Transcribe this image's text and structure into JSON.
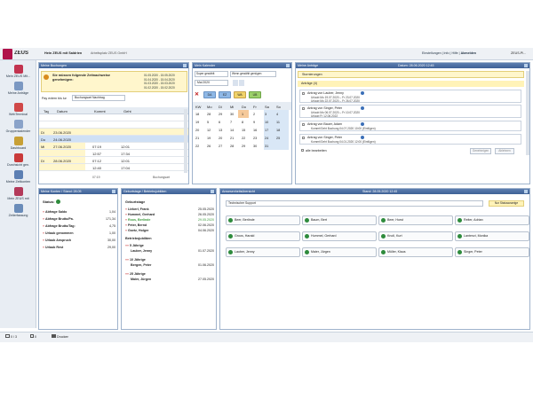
{
  "app": {
    "name": "ZEUS",
    "user": "Hein ZEUS mit Saldrien",
    "company": "Arbeitsplatz ZEUS GmbH",
    "header_links": [
      "Einstellungen",
      "Info",
      "Hilfe",
      "Abmelden"
    ],
    "version": "ZEUS-Pl..."
  },
  "sidebar": {
    "items": [
      {
        "label": "Mein ZEUS Mit..."
      },
      {
        "label": "Meine Anträge"
      },
      {
        "label": "WebTerminal"
      },
      {
        "label": "Gruppenkalender"
      },
      {
        "label": "Dashboard"
      },
      {
        "label": "Durchsicht gen."
      },
      {
        "label": "Meine Zeitkonten"
      },
      {
        "label": "Mein ZEUS mit"
      },
      {
        "label": "Zeiterfassung"
      }
    ]
  },
  "panels": {
    "buchungen": {
      "title": "Meine Buchungen",
      "notice": "Sie müssen folgende Zeitnachweise genehmigen:",
      "notice_dates": [
        "01.05.2020 - 15.05.2020",
        "01.04.2020 - 15.04.2020",
        "01.03.2020 - 15.03.2020",
        "01.02.2020 - 15.02.2020"
      ],
      "notice_dates2": [
        "31.05.2020",
        "30.04.2020",
        "31.03.2020",
        "29.02.2020"
      ],
      "filter_label": "Pay extern bis lur",
      "filter_value": "Buchungsart Nachtrag",
      "columns": [
        "Tag",
        "Datum",
        "Kommt",
        "Geht"
      ],
      "rows": [
        {
          "tag": "",
          "datum": "",
          "kommt": "",
          "geht": ""
        },
        {
          "tag": "",
          "datum": "",
          "kommt": "",
          "geht": ""
        },
        {
          "tag": "Di",
          "datum": "23.06.2020",
          "kommt": "",
          "geht": ""
        },
        {
          "tag": "Do",
          "datum": "24.06.2020",
          "kommt": "",
          "geht": ""
        },
        {
          "tag": "Mi",
          "datum": "27.06.2020",
          "kommt": "07:19",
          "geht": "12:01"
        },
        {
          "tag": "",
          "datum": "",
          "kommt": "12:57",
          "geht": "17:34"
        },
        {
          "tag": "Di",
          "datum": "28.06.2020",
          "kommt": "07:12",
          "geht": "12:01"
        },
        {
          "tag": "",
          "datum": "",
          "kommt": "12:40",
          "geht": "17:04"
        }
      ],
      "footer_left": "07:19",
      "footer_right": "Buchungsart"
    },
    "kalender": {
      "title": "Mein Kalender",
      "select1": "Super gewählt",
      "select2": "Wenn gewählt genügen",
      "month": "Mai 2020",
      "buttons": [
        "DA",
        "EZ",
        "WA",
        "UB"
      ],
      "weekdays": [
        "KW",
        "Mo",
        "Di",
        "Mi",
        "Do",
        "Fr",
        "Sa",
        "So"
      ],
      "weeks": [
        [
          "18",
          "28",
          "29",
          "30",
          "1",
          "2",
          "3",
          "4"
        ],
        [
          "19",
          "5",
          "6",
          "7",
          "8",
          "9",
          "10",
          "11"
        ],
        [
          "20",
          "12",
          "13",
          "14",
          "15",
          "16",
          "17",
          "18"
        ],
        [
          "21",
          "19",
          "20",
          "21",
          "22",
          "23",
          "24",
          "25"
        ],
        [
          "22",
          "26",
          "27",
          "28",
          "29",
          "30",
          "31",
          ""
        ]
      ]
    },
    "antraege": {
      "title": "Meine Anträge",
      "date": "Datum: 28.06.2020 12:45",
      "header": "Stornierungen",
      "tab": "Anträge (4)",
      "items": [
        {
          "title": "Antrag von Lauber, Jenny",
          "line1": "Urlaub Mo 19.07.2020 – Fr 23.07.2020",
          "line2": "Urlaub Mo 22.07.2020 – Fr 26.07.2020"
        },
        {
          "title": "Antrag von Singer, Peter",
          "line1": "Urlaub Mo 06.07.2020 – Fr 10.07.2020",
          "line2": "Urlaub Fr 12.06.2022"
        },
        {
          "title": "Antrag von Bauer, Adam",
          "line1": "Kommt/Geht Buchung 04.07.2020 10:00 (Einfügen)"
        },
        {
          "title": "Antrag von Singer, Peter",
          "line1": "Kommt/Geht Buchung 04.01.2020 12:00 (Einfügen)"
        }
      ],
      "select_all": "alle bearbeiten",
      "approve": "Genehmigen",
      "reject": "Ablehnen"
    },
    "konten": {
      "title": "Meine Konten / Stand: 28.05",
      "status": "Status:",
      "rows": [
        {
          "label": "Abfrage Saldo",
          "value": "1,04"
        },
        {
          "label": "Abfrage Brutto/Pa.",
          "value": "171,34"
        },
        {
          "label": "Abfrage Brutto/Tag:",
          "value": "4,75"
        },
        {
          "label": "Urlaub genommen",
          "value": "1,00"
        },
        {
          "label": "Urlaub Anspruch",
          "value": "30,00"
        },
        {
          "label": "Urlaub Rest",
          "value": "29,00"
        }
      ]
    },
    "geburtstage": {
      "title": "Geburtstage / Betriebsjubiläen",
      "sec1": "Geburtstage",
      "people": [
        {
          "name": "Lieberl, Frank",
          "date": "25.05.2020"
        },
        {
          "name": "Hummel, Gerhard",
          "date": "26.05.2020"
        },
        {
          "name": "Roos, Berlinde",
          "date": "29.05.2020"
        },
        {
          "name": "Peter, Bernd",
          "date": "02.06.2020"
        },
        {
          "name": "Goetz, Holger",
          "date": "04.06.2020"
        }
      ],
      "sec2": "Betriebsjubiläen",
      "jubilee": [
        {
          "label": "5 Jährige",
          "name": "Lauber, Jenny",
          "date": "01.07.2020"
        },
        {
          "label": "10 Jährige",
          "name": "Bergen, Peter",
          "date": "01.06.2020"
        },
        {
          "label": "25 Jährige",
          "name": "Maier, Jürgen",
          "date": "27.05.2020"
        }
      ]
    },
    "anwesenheit": {
      "title": "Anwesenheitsübersicht",
      "date": "Stand: 28.05.2020 12:45",
      "select": "Technischer Support",
      "filter": "Nur Statusanzeige",
      "people": [
        "Beer, Berlinde",
        "Baum, Bert",
        "Beer, Horst",
        "Reiter, Adrian",
        "Groos, Harald",
        "Hummel, Gerhard",
        "Knoll, Kurt",
        "Lantenzi, Monika",
        "Lauber, Jenny",
        "Maier, Jürgen",
        "Müller, Klaus",
        "Singer, Peter"
      ]
    }
  },
  "footer": {
    "items": [
      "0 / 3",
      "0",
      "Drucken"
    ]
  }
}
